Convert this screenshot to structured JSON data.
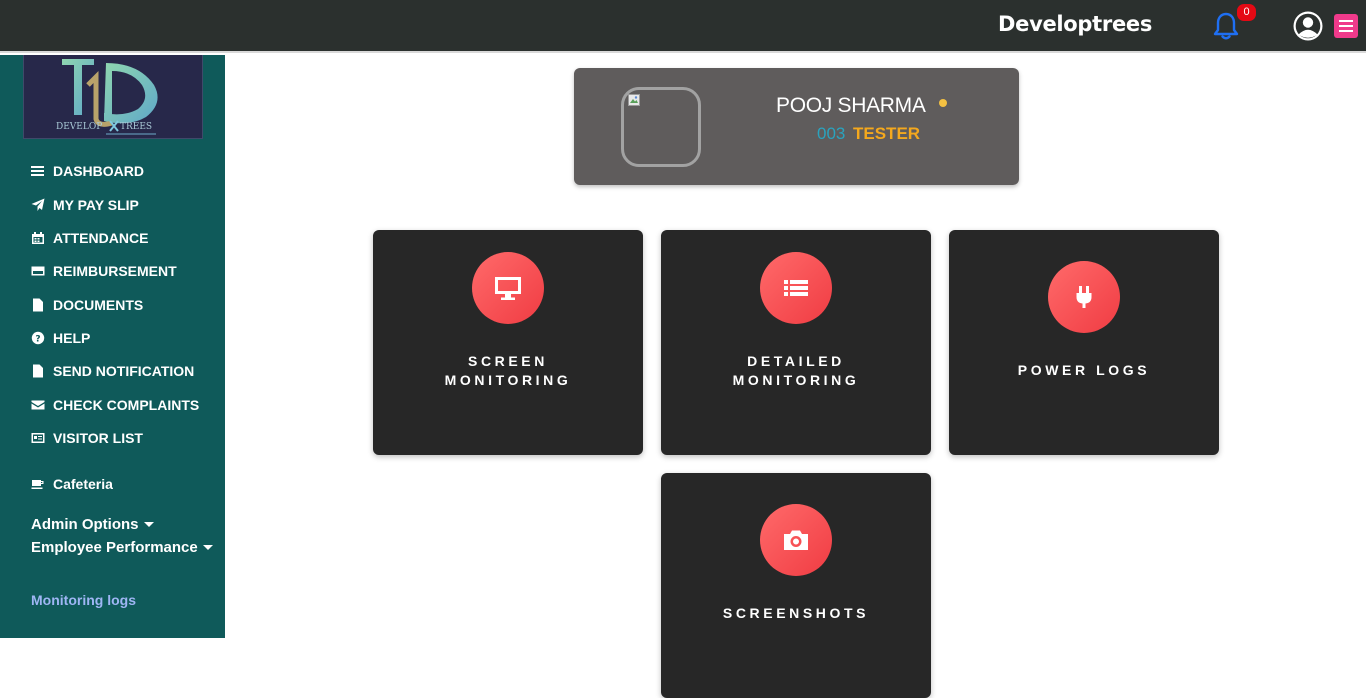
{
  "header": {
    "brand": "Developtrees",
    "notification_count": "0"
  },
  "sidebar": {
    "logo_text": "DEVELOPTREES",
    "items": [
      {
        "label": "DASHBOARD",
        "icon": "bars-icon"
      },
      {
        "label": "MY PAY SLIP",
        "icon": "paper-plane-icon"
      },
      {
        "label": "ATTENDANCE",
        "icon": "calendar-icon"
      },
      {
        "label": "REIMBURSEMENT",
        "icon": "credit-card-icon"
      },
      {
        "label": "DOCUMENTS",
        "icon": "file-icon"
      },
      {
        "label": "HELP",
        "icon": "question-circle-icon"
      },
      {
        "label": "SEND NOTIFICATION",
        "icon": "file-icon"
      },
      {
        "label": "CHECK COMPLAINTS",
        "icon": "envelope-icon"
      },
      {
        "label": "VISITOR LIST",
        "icon": "id-card-icon"
      },
      {
        "label": "Cafeteria",
        "icon": "coffee-icon"
      }
    ],
    "admin_options": "Admin Options",
    "employee_performance": "Employee Performance",
    "monitoring_logs": "Monitoring logs"
  },
  "profile": {
    "name": "POOJ SHARMA",
    "id": "003",
    "role": "TESTER",
    "status_color": "#f4c142"
  },
  "tiles": [
    {
      "line1": "SCREEN",
      "line2": "MONITORING",
      "icon": "desktop-icon"
    },
    {
      "line1": "DETAILED",
      "line2": "MONITORING",
      "icon": "list-icon"
    },
    {
      "line1": "POWER LOGS",
      "line2": "",
      "icon": "plug-icon"
    },
    {
      "line1": "SCREENSHOTS",
      "line2": "",
      "icon": "camera-icon"
    }
  ],
  "colors": {
    "topbar": "#2b302e",
    "sidebar": "#0f5a5a",
    "accent": "#f03c43",
    "menu_button": "#f03a8b"
  }
}
